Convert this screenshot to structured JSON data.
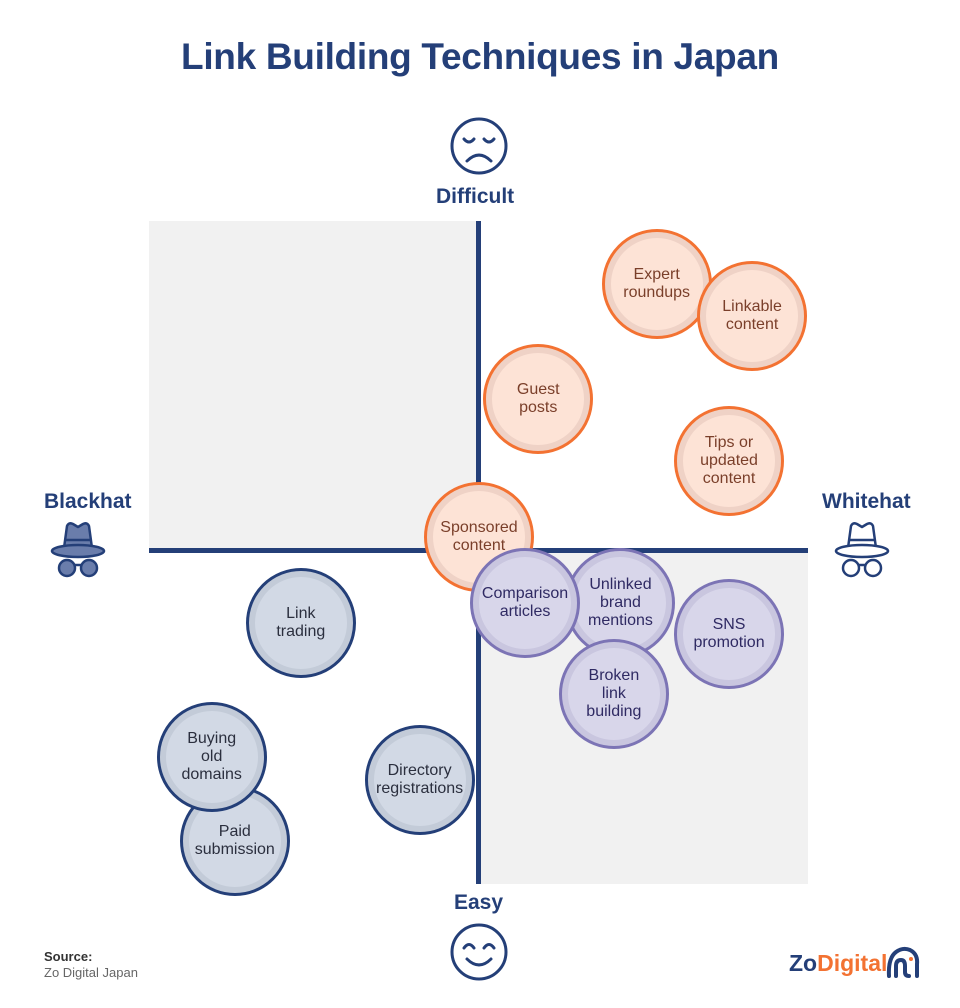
{
  "title": "Link Building Techniques in Japan",
  "axes": {
    "top": "Difficult",
    "bottom": "Easy",
    "left": "Blackhat",
    "right": "Whitehat"
  },
  "icons": {
    "top": "sad-face-icon",
    "bottom": "smiling-face-icon",
    "left": "blackhat-spy-icon",
    "right": "whitehat-spy-icon",
    "logo": "zodigital-elephant-icon"
  },
  "colors": {
    "navy": "#243f78",
    "orange": "#f37232",
    "purple": "#7c74b5",
    "panel_gray": "#f1f1f1"
  },
  "chart_data": {
    "type": "scatter",
    "title": "Link Building Techniques in Japan",
    "xlabel_left": "Blackhat",
    "xlabel_right": "Whitehat",
    "ylabel_top": "Difficult",
    "ylabel_bottom": "Easy",
    "xlim": [
      -1,
      1
    ],
    "ylim": [
      -1,
      1
    ],
    "legend": "none",
    "groups": {
      "orange": "Whitehat / difficult",
      "purple": "Whitehat / easy",
      "navy": "Blackhat / easy"
    },
    "points": [
      {
        "label": "Expert\nroundups",
        "x": 0.54,
        "y": 0.81,
        "group": "orange"
      },
      {
        "label": "Linkable\ncontent",
        "x": 0.83,
        "y": 0.71,
        "group": "orange"
      },
      {
        "label": "Guest\nposts",
        "x": 0.18,
        "y": 0.46,
        "group": "orange"
      },
      {
        "label": "Tips or\nupdated\ncontent",
        "x": 0.76,
        "y": 0.27,
        "group": "orange"
      },
      {
        "label": "Sponsored\ncontent",
        "x": 0.0,
        "y": 0.04,
        "group": "orange"
      },
      {
        "label": "Comparison\narticles",
        "x": 0.14,
        "y": -0.16,
        "group": "purple"
      },
      {
        "label": "Unlinked\nbrand\nmentions",
        "x": 0.43,
        "y": -0.16,
        "group": "purple"
      },
      {
        "label": "SNS\npromotion",
        "x": 0.76,
        "y": -0.25,
        "group": "purple"
      },
      {
        "label": "Broken\nlink\nbuilding",
        "x": 0.41,
        "y": -0.43,
        "group": "purple"
      },
      {
        "label": "Link\ntrading",
        "x": -0.54,
        "y": -0.22,
        "group": "navy"
      },
      {
        "label": "Buying\nold\ndomains",
        "x": -0.81,
        "y": -0.62,
        "group": "navy"
      },
      {
        "label": "Paid\nsubmission",
        "x": -0.74,
        "y": -0.87,
        "group": "navy"
      },
      {
        "label": "Directory\nregistrations",
        "x": -0.18,
        "y": -0.69,
        "group": "navy"
      }
    ]
  },
  "footer": {
    "source_label": "Source:",
    "source_value": "Zo Digital Japan",
    "logo_zo": "Zo",
    "logo_digital": "Digital"
  }
}
